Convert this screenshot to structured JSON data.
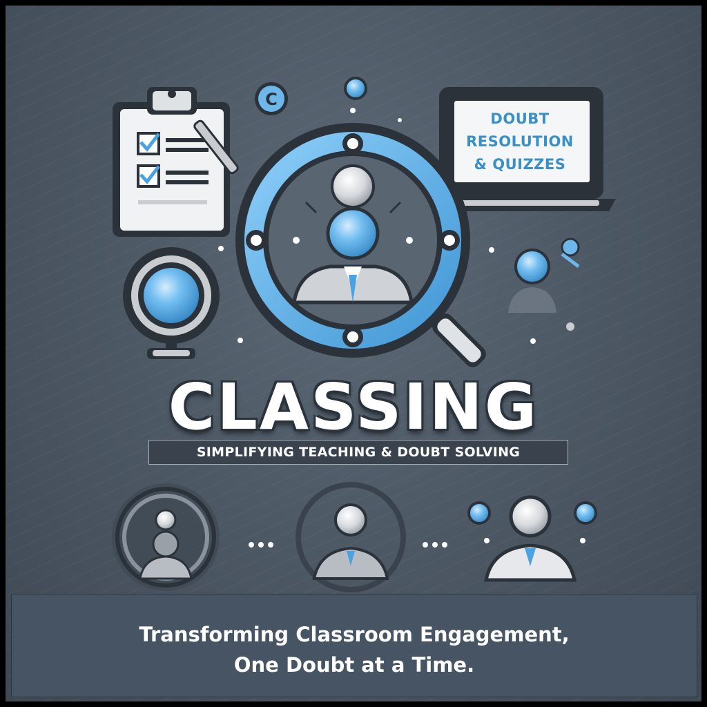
{
  "monitor": {
    "line1": "DOUBT",
    "line2": "RESOLUTION",
    "line3": "& QUIZZES"
  },
  "brand": {
    "name": "CLASSING",
    "tagline": "SIMPLIFYING TEACHING & DOUBT SOLVING"
  },
  "footer": {
    "line1": "Transforming Classroom Engagement,",
    "line2": "One Doubt at a Time."
  },
  "colors": {
    "accent_blue": "#5fb3ec",
    "background": "#4e5966",
    "footer_panel": "#465463"
  },
  "icons": [
    "clipboard-checklist-icon",
    "copyright-icon",
    "laptop-icon",
    "magnifier-user-icon",
    "globe-icon",
    "user-icon"
  ]
}
